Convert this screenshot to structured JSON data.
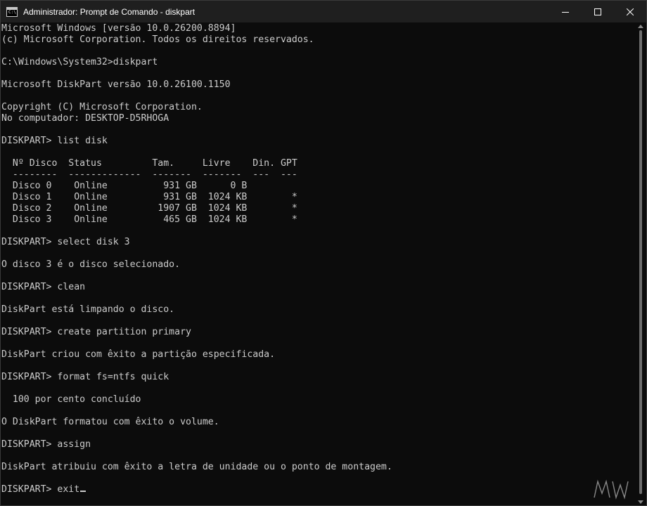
{
  "window": {
    "title": "Administrador: Prompt de Comando - diskpart",
    "icon": "cmd-icon",
    "icon_glyph": "C:\\",
    "controls": [
      "minimize-icon",
      "maximize-icon",
      "close-icon"
    ]
  },
  "colors": {
    "background": "#0c0c0c",
    "titlebar": "#1f1f1f",
    "text": "#cccccc"
  },
  "console": {
    "lines": [
      "Microsoft Windows [versão 10.0.26200.8894]",
      "(c) Microsoft Corporation. Todos os direitos reservados.",
      "",
      "C:\\Windows\\System32>diskpart",
      "",
      "Microsoft DiskPart versão 10.0.26100.1150",
      "",
      "Copyright (C) Microsoft Corporation.",
      "No computador: DESKTOP-D5RHOGA",
      "",
      "DISKPART> list disk",
      "",
      "  Nº Disco  Status         Tam.     Livre    Din. GPT",
      "  --------  -------------  -------  -------  ---  ---",
      "  Disco 0    Online          931 GB      0 B",
      "  Disco 1    Online          931 GB  1024 KB        *",
      "  Disco 2    Online         1907 GB  1024 KB        *",
      "  Disco 3    Online          465 GB  1024 KB        *",
      "",
      "DISKPART> select disk 3",
      "",
      "O disco 3 é o disco selecionado.",
      "",
      "DISKPART> clean",
      "",
      "DiskPart está limpando o disco.",
      "",
      "DISKPART> create partition primary",
      "",
      "DiskPart criou com êxito a partição especificada.",
      "",
      "DISKPART> format fs=ntfs quick",
      "",
      "  100 por cento concluído",
      "",
      "O DiskPart formatou com êxito o volume.",
      "",
      "DISKPART> assign",
      "",
      "DiskPart atribuiu com êxito a letra de unidade ou o ponto de montagem.",
      "",
      "DISKPART> exit"
    ]
  },
  "watermark": {
    "text": "MW"
  }
}
